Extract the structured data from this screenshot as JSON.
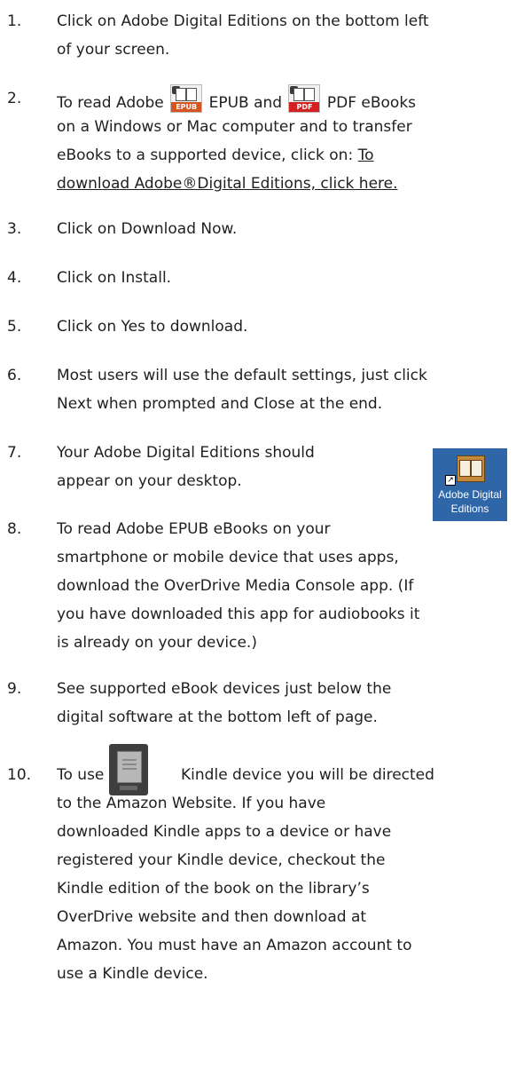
{
  "steps": [
    {
      "number": "1.",
      "lines": [
        "Click on Adobe Digital Editions on the bottom left",
        "of your screen."
      ]
    },
    {
      "number": "2.",
      "line1": {
        "a": "To read Adobe ",
        "b": " EPUB and ",
        "c": " PDF eBooks"
      },
      "lines": [
        "on a Windows or Mac computer and to transfer",
        "eBooks to a supported device,  click on: "
      ],
      "link": {
        "part1": "To",
        "part2": "download Adobe®Digital Editions, click here."
      },
      "icons": {
        "epub": "EPUB",
        "pdf": "PDF"
      }
    },
    {
      "number": "3.",
      "lines": [
        "Click on Download Now."
      ]
    },
    {
      "number": "4.",
      "lines": [
        "Click on Install."
      ]
    },
    {
      "number": "5.",
      "lines": [
        "Click on Yes to download."
      ]
    },
    {
      "number": "6.",
      "lines": [
        "Most users will use the default settings, just click",
        "Next when prompted and Close at the end."
      ]
    },
    {
      "number": "7.",
      "lines": [
        "Your Adobe Digital Editions should",
        "appear on your desktop."
      ]
    },
    {
      "number": "8.",
      "lines": [
        "To read Adobe EPUB eBooks on your",
        "smartphone or mobile device that uses apps,",
        "download the OverDrive Media Console app. (If",
        "you have downloaded this app for audiobooks it",
        "is already on your device.)"
      ]
    },
    {
      "number": "9.",
      "lines": [
        "See supported eBook devices  just below the",
        "digital software at the bottom left of page."
      ]
    },
    {
      "number": "10.",
      "line1": {
        "a": "To use a ",
        "b": " Kindle device you will be directed"
      },
      "lines": [
        "to the             Amazon Website.  If you have",
        "downloaded Kindle apps to a device or have",
        "registered your Kindle device,  checkout the",
        "Kindle edition of the book on the library’s",
        "OverDrive website and then download at",
        "Amazon.  You must have an Amazon account to",
        "use a Kindle device."
      ]
    }
  ],
  "desktop_icon": {
    "label_line1": "Adobe Digital",
    "label_line2": "Editions",
    "arrow": "↗"
  },
  "colors": {
    "epub_badge": "#d9531e",
    "pdf_badge": "#d42020",
    "desktop_bg": "#2f66a8"
  }
}
